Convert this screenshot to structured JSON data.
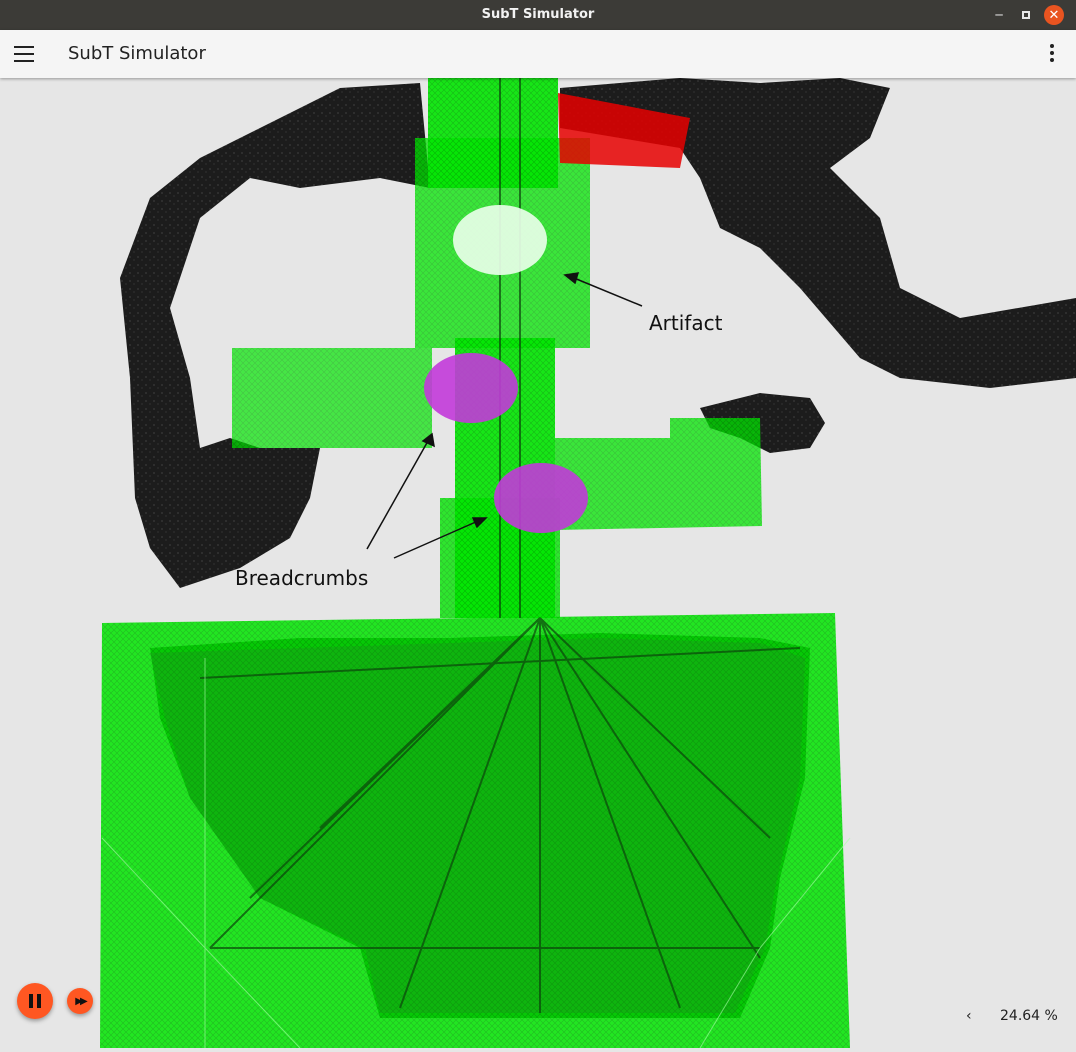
{
  "window": {
    "title": "SubT Simulator"
  },
  "toolbar": {
    "title": "SubT Simulator"
  },
  "scene": {
    "annotations": {
      "artifact": "Artifact",
      "breadcrumbs": "Breadcrumbs"
    },
    "colors": {
      "tunnel": "#1a1a1a",
      "mapped": "#00e600",
      "highlight": "#e60000",
      "breadcrumb": "#c23ad9",
      "artifact": "#e8ffe8",
      "background": "#e6e6e6"
    }
  },
  "controls": {
    "pause": "pause-icon",
    "fast_forward": "fast-forward-icon"
  },
  "status": {
    "zoom": "24.64 %"
  }
}
